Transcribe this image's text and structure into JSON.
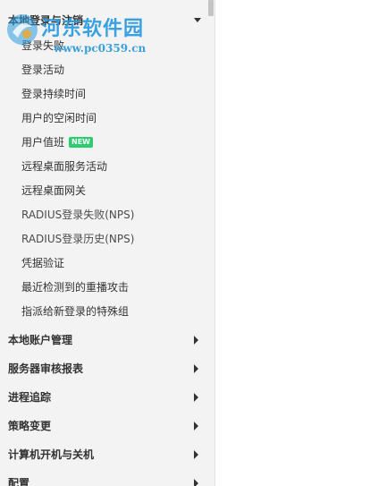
{
  "sidebar": {
    "expanded_section": {
      "label": "本地登录与注销",
      "items": [
        {
          "label": "登录失败"
        },
        {
          "label": "登录活动"
        },
        {
          "label": "登录持续时间"
        },
        {
          "label": "用户的空闲时间"
        },
        {
          "label": "用户值班",
          "badge": "NEW"
        },
        {
          "label": "远程桌面服务活动"
        },
        {
          "label": "远程桌面网关"
        },
        {
          "label": "RADIUS登录失败(NPS)"
        },
        {
          "label": "RADIUS登录历史(NPS)"
        },
        {
          "label": "凭据验证"
        },
        {
          "label": "最近检测到的重播攻击"
        },
        {
          "label": "指派给新登录的特殊组"
        }
      ]
    },
    "collapsed_sections": [
      {
        "label": "本地账户管理"
      },
      {
        "label": "服务器审核报表"
      },
      {
        "label": "进程追踪"
      },
      {
        "label": "策略变更"
      },
      {
        "label": "计算机开机与关机"
      },
      {
        "label": "配置"
      }
    ],
    "badge_color": "#2ecc71"
  },
  "watermark": {
    "site_name": "河东软件园",
    "url": "www.pc0359.cn"
  }
}
